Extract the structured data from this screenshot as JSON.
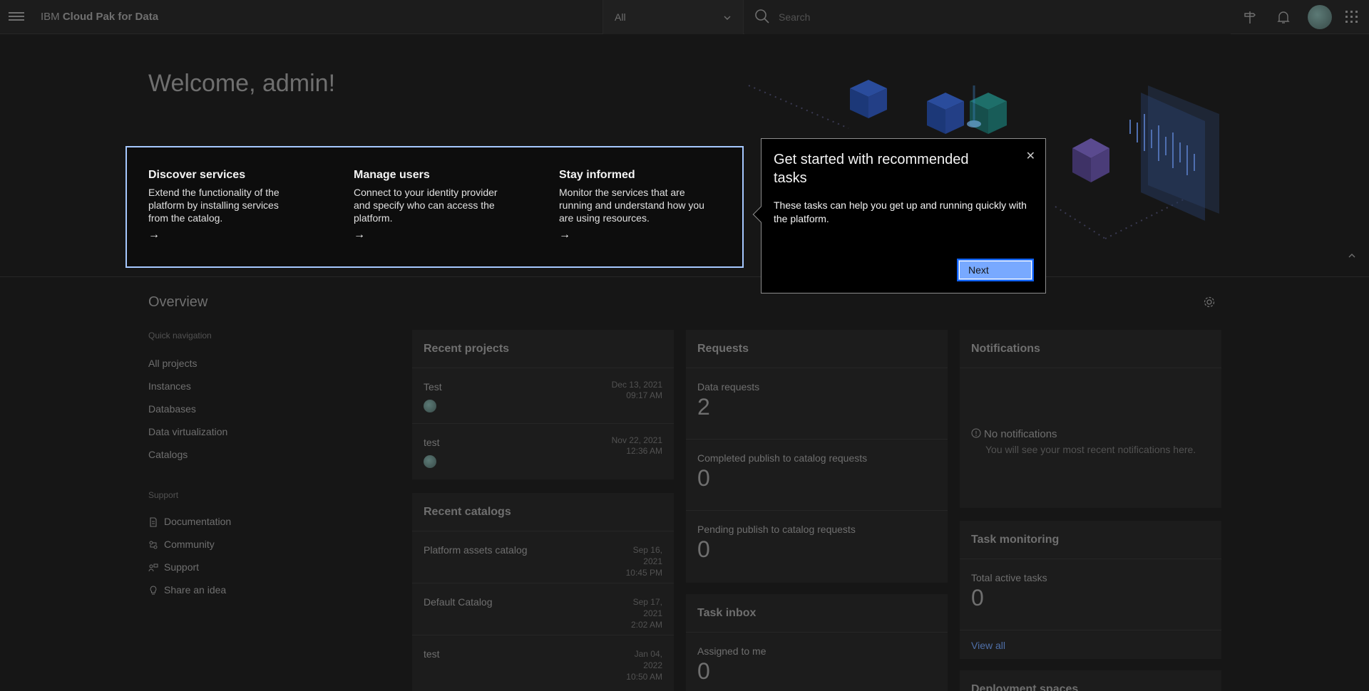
{
  "header": {
    "brand_prefix": "IBM",
    "brand_name": "Cloud Pak for Data",
    "scope_value": "All",
    "search_placeholder": "Search"
  },
  "hero": {
    "welcome": "Welcome, admin!",
    "tasks": [
      {
        "title": "Discover services",
        "desc": "Extend the functionality of the platform by installing services from the catalog.",
        "arrow": "→"
      },
      {
        "title": "Manage users",
        "desc": "Connect to your identity provider and specify who can access the platform.",
        "arrow": "→"
      },
      {
        "title": "Stay informed",
        "desc": "Monitor the services that are running and understand how you are using resources.",
        "arrow": "→"
      }
    ]
  },
  "popover": {
    "title": "Get started with recommended tasks",
    "body": "These tasks can help you get up and running quickly with the platform.",
    "next_label": "Next",
    "close_glyph": "✕"
  },
  "overview": {
    "title": "Overview",
    "quick_nav_label": "Quick navigation",
    "quick_nav": [
      "All projects",
      "Instances",
      "Databases",
      "Data virtualization",
      "Catalogs"
    ],
    "support_label": "Support",
    "support": [
      {
        "label": "Documentation",
        "icon": "document-icon"
      },
      {
        "label": "Community",
        "icon": "community-icon"
      },
      {
        "label": "Support",
        "icon": "support-icon"
      },
      {
        "label": "Share an idea",
        "icon": "idea-icon"
      }
    ]
  },
  "recent_projects": {
    "title": "Recent projects",
    "items": [
      {
        "name": "Test",
        "date": "Dec 13, 2021",
        "time": "09:17 AM"
      },
      {
        "name": "test",
        "date": "Nov 22, 2021",
        "time": "12:36 AM"
      }
    ]
  },
  "recent_catalogs": {
    "title": "Recent catalogs",
    "items": [
      {
        "name": "Platform assets catalog",
        "d1": "Sep 16,",
        "d2": "2021",
        "d3": "10:45 PM"
      },
      {
        "name": "Default Catalog",
        "d1": "Sep 17,",
        "d2": "2021",
        "d3": "2:02 AM"
      },
      {
        "name": "test",
        "d1": "Jan 04,",
        "d2": "2022",
        "d3": "10:50 AM"
      }
    ]
  },
  "requests": {
    "title": "Requests",
    "items": [
      {
        "label": "Data requests",
        "value": "2"
      },
      {
        "label": "Completed publish to catalog requests",
        "value": "0"
      },
      {
        "label": "Pending publish to catalog requests",
        "value": "0"
      }
    ]
  },
  "task_inbox": {
    "title": "Task inbox",
    "label": "Assigned to me",
    "value": "0"
  },
  "notifications": {
    "title": "Notifications",
    "empty_title": "No notifications",
    "empty_sub": "You will see your most recent notifications here."
  },
  "task_monitoring": {
    "title": "Task monitoring",
    "label": "Total active tasks",
    "value": "0",
    "view_all": "View all"
  },
  "deployment_spaces": {
    "title": "Deployment spaces"
  }
}
